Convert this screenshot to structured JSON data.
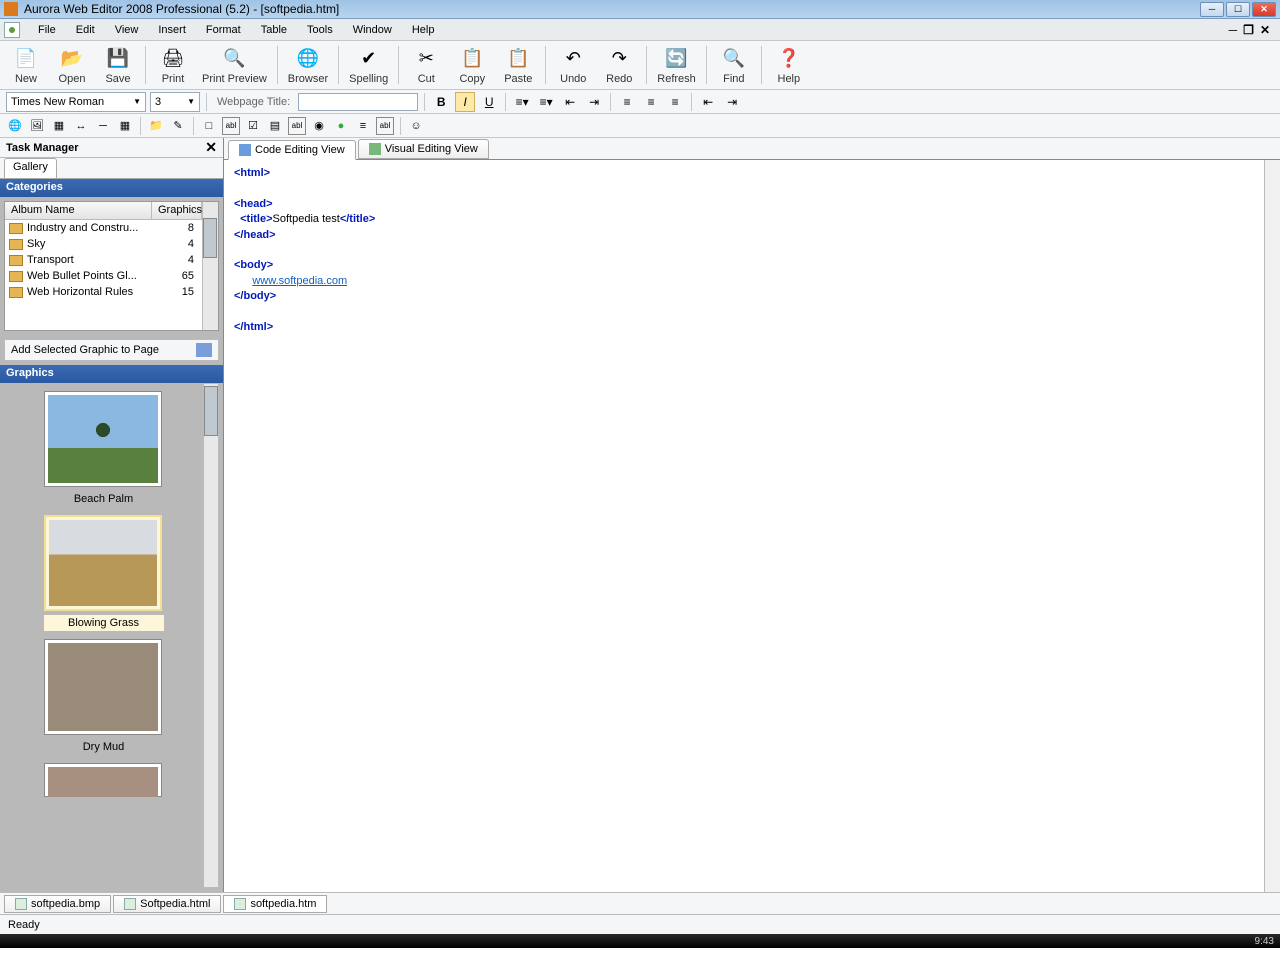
{
  "window": {
    "title": "Aurora Web Editor 2008 Professional (5.2) - [softpedia.htm]"
  },
  "menu": [
    "File",
    "Edit",
    "View",
    "Insert",
    "Format",
    "Table",
    "Tools",
    "Window",
    "Help"
  ],
  "toolbar": [
    {
      "label": "New",
      "icon": "📄"
    },
    {
      "label": "Open",
      "icon": "📂"
    },
    {
      "label": "Save",
      "icon": "💾"
    },
    {
      "label": "Print",
      "icon": "🖨"
    },
    {
      "label": "Print Preview",
      "icon": "🔍",
      "wide": true
    },
    {
      "label": "Browser",
      "icon": "🌐"
    },
    {
      "label": "Spelling",
      "icon": "✔"
    },
    {
      "label": "Cut",
      "icon": "✂"
    },
    {
      "label": "Copy",
      "icon": "📋"
    },
    {
      "label": "Paste",
      "icon": "📋"
    },
    {
      "label": "Undo",
      "icon": "↶"
    },
    {
      "label": "Redo",
      "icon": "↷"
    },
    {
      "label": "Refresh",
      "icon": "🔄"
    },
    {
      "label": "Find",
      "icon": "🔍"
    },
    {
      "label": "Help",
      "icon": "❓"
    }
  ],
  "format": {
    "font": "Times New Roman",
    "size": "3",
    "title_label": "Webpage Title:",
    "title_value": ""
  },
  "sidebar": {
    "task_manager": "Task Manager",
    "gallery_tab": "Gallery",
    "categories_header": "Categories",
    "col_album": "Album Name",
    "col_graphics": "Graphics",
    "categories": [
      {
        "name": "Industry and Constru...",
        "count": 8
      },
      {
        "name": "Sky",
        "count": 4
      },
      {
        "name": "Transport",
        "count": 4
      },
      {
        "name": "Web Bullet Points Gl...",
        "count": 65
      },
      {
        "name": "Web Horizontal Rules",
        "count": 15
      }
    ],
    "add_graphic": "Add Selected Graphic to Page",
    "graphics_header": "Graphics",
    "graphics": [
      {
        "name": "Beach Palm"
      },
      {
        "name": "Blowing Grass",
        "selected": true
      },
      {
        "name": "Dry Mud"
      }
    ]
  },
  "editor": {
    "tabs": [
      {
        "label": "Code Editing View",
        "active": true
      },
      {
        "label": "Visual Editing View"
      }
    ],
    "code_lines": [
      {
        "t": "tag",
        "v": "<html>"
      },
      {
        "t": "blank"
      },
      {
        "t": "tag",
        "v": "<head>"
      },
      {
        "t": "title",
        "open": "<title>",
        "text": "Softpedia test",
        "close": "</title>"
      },
      {
        "t": "tag",
        "v": "</head>"
      },
      {
        "t": "blank"
      },
      {
        "t": "tag",
        "v": "<body>"
      },
      {
        "t": "link",
        "v": "www.softpedia.com"
      },
      {
        "t": "tag",
        "v": "</body>"
      },
      {
        "t": "blank"
      },
      {
        "t": "tag",
        "v": "</html>"
      }
    ]
  },
  "doc_tabs": [
    "softpedia.bmp",
    "Softpedia.html",
    "softpedia.htm"
  ],
  "doc_active": 2,
  "status": "Ready",
  "taskbar_time": "9:43"
}
